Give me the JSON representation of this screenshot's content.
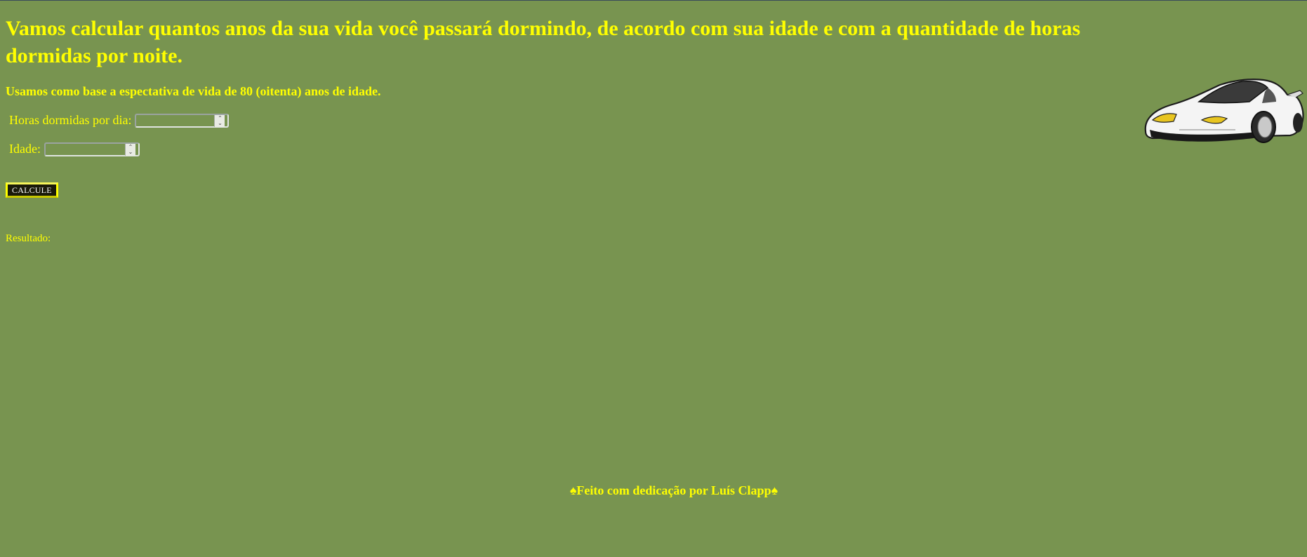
{
  "page": {
    "headline": "Vamos calcular quantos anos da sua vida você passará dormindo, de acordo com sua idade e com a quantidade de horas dormidas por noite.",
    "subheadline": "Usamos como base a espectativa de vida de 80 (oitenta) anos de idade."
  },
  "form": {
    "hours_label": "Horas dormidas por dia:",
    "hours_value": "",
    "age_label": "Idade:",
    "age_value": "",
    "calculate_label": "CALCULE"
  },
  "result": {
    "label": "Resultado:"
  },
  "footer": {
    "text": "♠Feito com dedicação por Luís Clapp♠"
  },
  "decor": {
    "car_image": "white-sports-car",
    "colors": {
      "background": "#789450",
      "text": "#ffff00",
      "button_bg": "#1a1a0a",
      "button_border": "#ffff00"
    }
  }
}
